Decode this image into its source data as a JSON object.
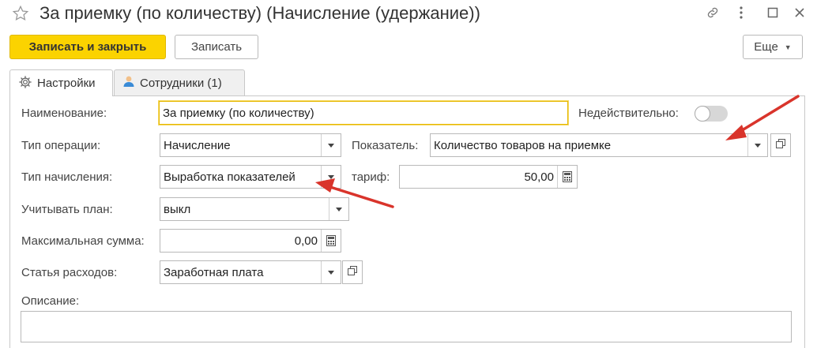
{
  "window": {
    "title": "За приемку (по количеству) (Начисление (удержание))"
  },
  "toolbar": {
    "save_close_label": "Записать и закрыть",
    "save_label": "Записать",
    "more_label": "Еще"
  },
  "tabs": [
    {
      "label": "Настройки",
      "icon": "gear-icon",
      "active": true
    },
    {
      "label": "Сотрудники (1)",
      "icon": "user-icon",
      "active": false
    }
  ],
  "form": {
    "name_label": "Наименование:",
    "name_value": "За приемку (по количеству)",
    "invalid_label": "Недействительно:",
    "invalid_on": false,
    "op_type_label": "Тип операции:",
    "op_type_value": "Начисление",
    "indicator_label": "Показатель:",
    "indicator_value": "Количество товаров на приемке",
    "accrual_type_label": "Тип начисления:",
    "accrual_type_value": "Выработка показателей",
    "tariff_label": "тариф:",
    "tariff_value": "50,00",
    "plan_label": "Учитывать план:",
    "plan_value": "выкл",
    "max_sum_label": "Максимальная сумма:",
    "max_sum_value": "0,00",
    "expense_label": "Статья расходов:",
    "expense_value": "Заработная плата",
    "description_label": "Описание:",
    "description_value": ""
  },
  "colors": {
    "primary_button": "#fbd300",
    "arrow": "#d9342b",
    "focus_border": "#e6b800"
  }
}
